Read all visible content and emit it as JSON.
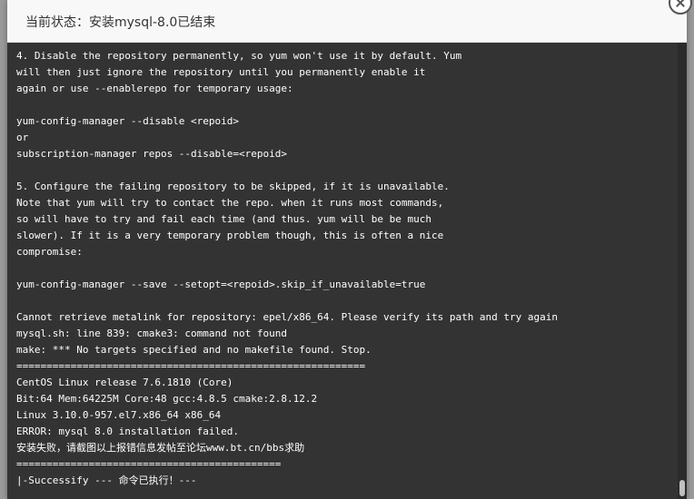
{
  "dialog": {
    "title": "当前状态：安装mysql-8.0已结束"
  },
  "terminal": {
    "lines": [
      "4. Disable the repository permanently, so yum won't use it by default. Yum",
      "will then just ignore the repository until you permanently enable it",
      "again or use --enablerepo for temporary usage:",
      "",
      "yum-config-manager --disable <repoid>",
      "or",
      "subscription-manager repos --disable=<repoid>",
      "",
      "5. Configure the failing repository to be skipped, if it is unavailable.",
      "Note that yum will try to contact the repo. when it runs most commands,",
      "so will have to try and fail each time (and thus. yum will be be much",
      "slower). If it is a very temporary problem though, this is often a nice",
      "compromise:",
      "",
      "yum-config-manager --save --setopt=<repoid>.skip_if_unavailable=true",
      "",
      "Cannot retrieve metalink for repository: epel/x86_64. Please verify its path and try again",
      "mysql.sh: line 839: cmake3: command not found",
      "make: *** No targets specified and no makefile found. Stop.",
      "==========================================================",
      "CentOS Linux release 7.6.1810 (Core)",
      "Bit:64 Mem:64225M Core:48 gcc:4.8.5 cmake:2.8.12.2",
      "Linux 3.10.0-957.el7.x86_64 x86_64",
      "ERROR: mysql 8.0 installation failed.",
      "安装失败，请截图以上报错信息发帖至论坛www.bt.cn/bbs求助",
      "============================================",
      "|-Successify --- 命令已执行！---"
    ]
  }
}
